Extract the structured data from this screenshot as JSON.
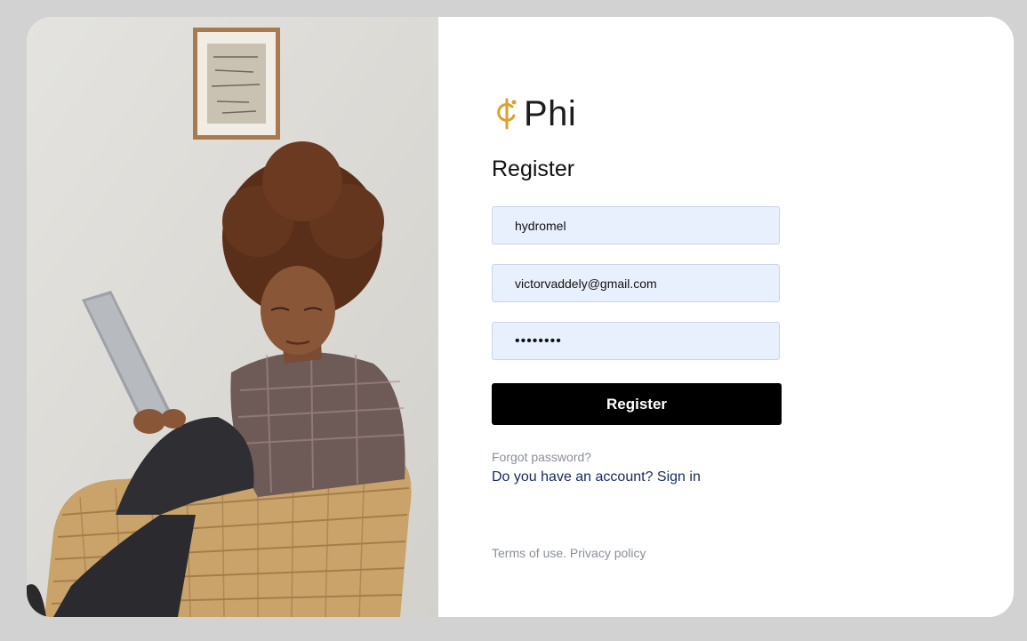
{
  "brand": {
    "name": "Phi",
    "logo_icon": "phi-logo-icon",
    "accent_color": "#d9a12e"
  },
  "form": {
    "title": "Register",
    "username_value": "hydromel",
    "email_value": "victorvaddely@gmail.com",
    "password_value": "••••••••",
    "input_background": "#e8f0fd",
    "submit_label": "Register"
  },
  "links": {
    "forgot_password": "Forgot password?",
    "account_prompt": "Do you have an account?",
    "sign_in": "Sign in"
  },
  "footer": {
    "terms": "Terms of use.",
    "privacy": "Privacy policy"
  }
}
